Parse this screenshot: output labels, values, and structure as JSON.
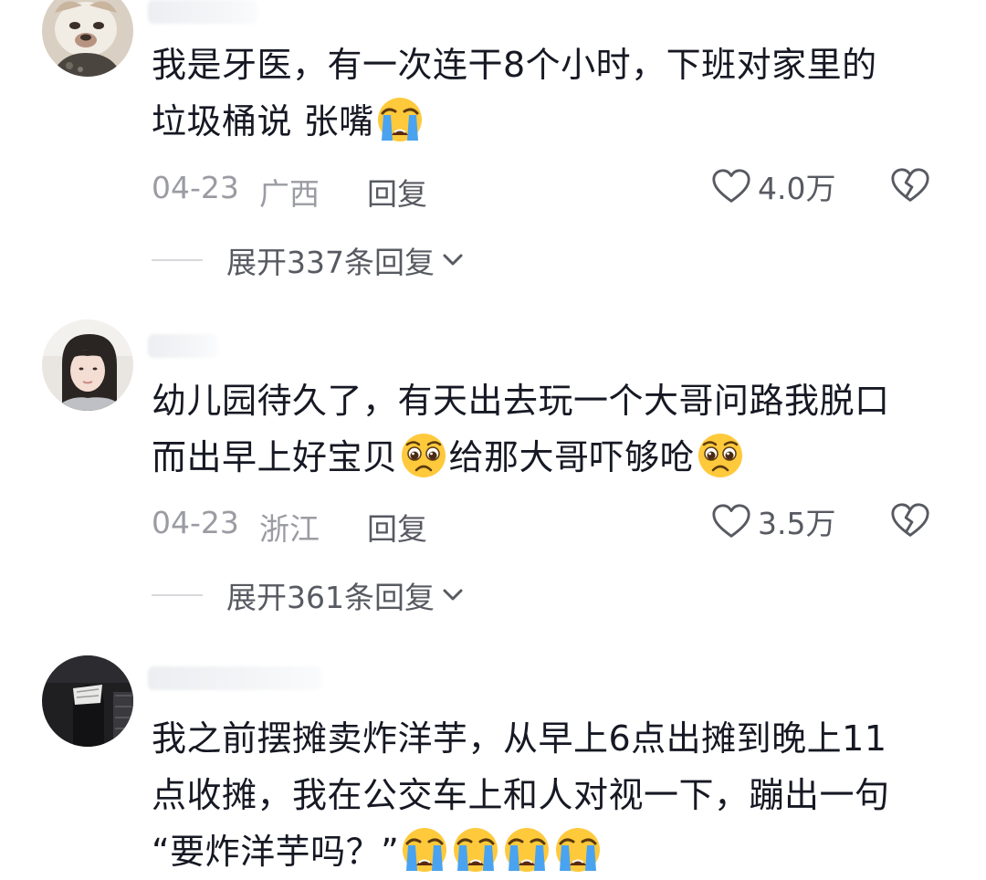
{
  "comments": [
    {
      "lines": [
        "我是牙医，有一次连干8个小时，下班对家里的",
        "垃圾桶说 张嘴"
      ],
      "date": "04-23",
      "region": "广西",
      "reply_label": "回复",
      "likes": "4.0万",
      "expand_label": "展开337条回复"
    },
    {
      "lines": [
        "幼儿园待久了，有天出去玩一个大哥问路我脱口",
        "而出早上好宝贝",
        "给那大哥吓够呛"
      ],
      "date": "04-23",
      "region": "浙江",
      "reply_label": "回复",
      "likes": "3.5万",
      "expand_label": "展开361条回复"
    },
    {
      "lines": [
        "我之前摆摊卖炸洋芋，从早上6点出摊到晚上11",
        "点收摊，我在公交车上和人对视一下，蹦出一句",
        "“要炸洋芋吗？”"
      ]
    }
  ],
  "icons": {
    "like": "heart-outline-icon",
    "dislike": "broken-heart-icon",
    "expand": "chevron-down-icon",
    "emoji_crying": "loudly-crying-face-emoji",
    "emoji_pleading": "pleading-face-emoji"
  },
  "colors": {
    "text": "#161823",
    "meta": "#9b9ca3",
    "action": "#585a62",
    "emoji_face": "#ffc93c",
    "emoji_tear": "#4aa3f0"
  }
}
